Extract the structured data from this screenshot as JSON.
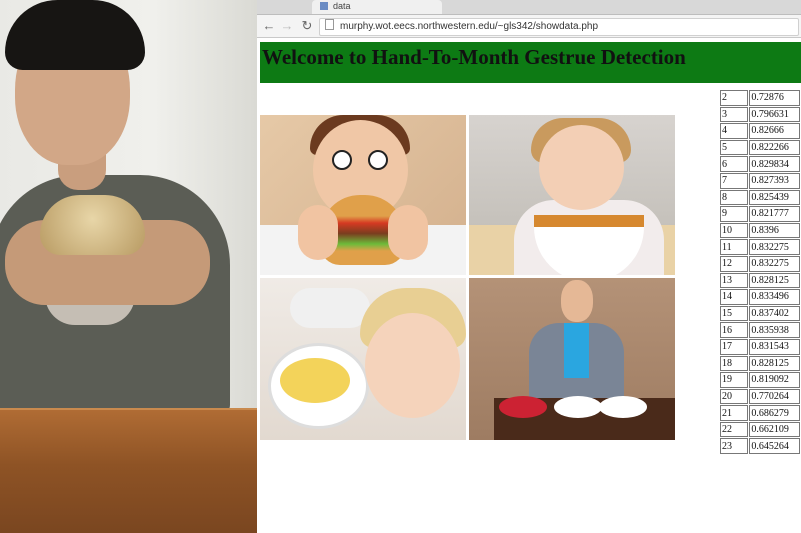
{
  "browser": {
    "tab_title": "data",
    "url": "murphy.wot.eecs.northwestern.edu/~gls342/showdata.php",
    "back_icon": "arrow-left-icon",
    "forward_icon": "arrow-right-icon",
    "reload_icon": "reload-icon"
  },
  "page": {
    "title": "Welcome to Hand-To-Month Gestrue Detection",
    "header_color": "#0d7a14"
  },
  "data_table": [
    {
      "index": "2",
      "value": "0.72876"
    },
    {
      "index": "3",
      "value": "0.796631"
    },
    {
      "index": "4",
      "value": "0.82666"
    },
    {
      "index": "5",
      "value": "0.822266"
    },
    {
      "index": "6",
      "value": "0.829834"
    },
    {
      "index": "7",
      "value": "0.827393"
    },
    {
      "index": "8",
      "value": "0.825439"
    },
    {
      "index": "9",
      "value": "0.821777"
    },
    {
      "index": "10",
      "value": "0.8396"
    },
    {
      "index": "11",
      "value": "0.832275"
    },
    {
      "index": "12",
      "value": "0.832275"
    },
    {
      "index": "13",
      "value": "0.828125"
    },
    {
      "index": "14",
      "value": "0.833496"
    },
    {
      "index": "15",
      "value": "0.837402"
    },
    {
      "index": "16",
      "value": "0.835938"
    },
    {
      "index": "17",
      "value": "0.831543"
    },
    {
      "index": "18",
      "value": "0.828125"
    },
    {
      "index": "19",
      "value": "0.819092"
    },
    {
      "index": "20",
      "value": "0.770264"
    },
    {
      "index": "21",
      "value": "0.686279"
    },
    {
      "index": "22",
      "value": "0.662109"
    },
    {
      "index": "23",
      "value": "0.645264"
    }
  ]
}
